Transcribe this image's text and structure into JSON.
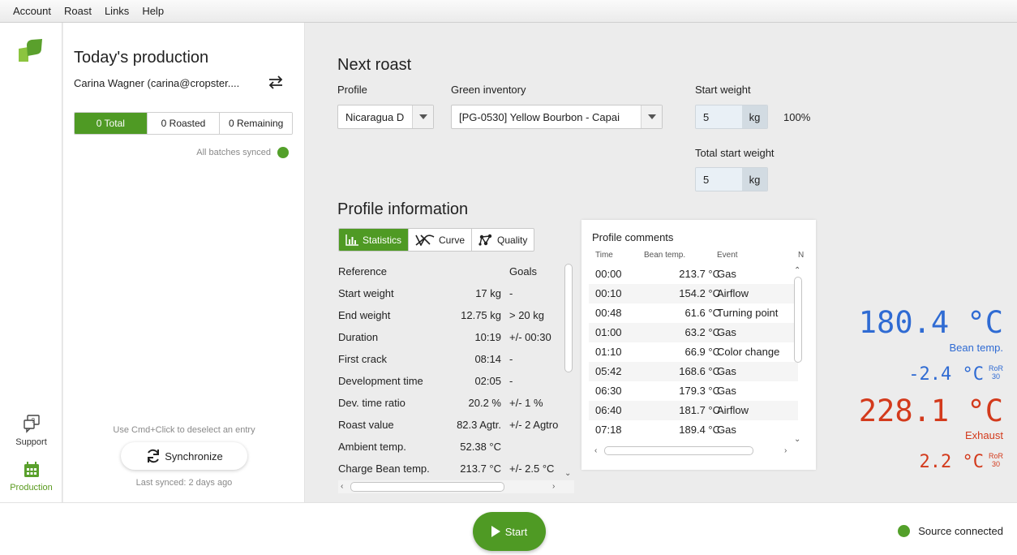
{
  "menu": [
    "Account",
    "Roast",
    "Links",
    "Help"
  ],
  "rail": {
    "support_label": "Support",
    "production_label": "Production"
  },
  "production": {
    "title": "Today's production",
    "user": "Carina Wagner (carina@cropster....",
    "segments": [
      "0 Total",
      "0 Roasted",
      "0 Remaining"
    ],
    "synced_text": "All batches synced",
    "hint": "Use Cmd+Click to deselect an entry",
    "sync_button": "Synchronize",
    "last_synced": "Last synced: 2 days ago"
  },
  "next_roast": {
    "title": "Next roast",
    "profile_label": "Profile",
    "profile_value": "Nicaragua D",
    "inventory_label": "Green inventory",
    "inventory_value": "[PG-0530] Yellow Bourbon - Capai",
    "start_weight_label": "Start weight",
    "start_weight_value": "5",
    "start_weight_unit": "kg",
    "start_weight_pct": "100%",
    "total_start_weight_label": "Total start weight",
    "total_start_weight_value": "5",
    "total_start_weight_unit": "kg"
  },
  "profile_info": {
    "title": "Profile information",
    "tabs": [
      "Statistics",
      "Curve",
      "Quality"
    ],
    "header": {
      "name": "Reference",
      "goal": "Goals"
    },
    "rows": [
      {
        "name": "Start weight",
        "value": "17 kg",
        "goal": "-"
      },
      {
        "name": "End weight",
        "value": "12.75 kg",
        "goal": "> 20 kg"
      },
      {
        "name": "Duration",
        "value": "10:19",
        "goal": "+/- 00:30"
      },
      {
        "name": "First crack",
        "value": "08:14",
        "goal": "-"
      },
      {
        "name": "Development time",
        "value": "02:05",
        "goal": "-"
      },
      {
        "name": "Dev. time ratio",
        "value": "20.2 %",
        "goal": "+/- 1 %"
      },
      {
        "name": "Roast value",
        "value": "82.3 Agtr.",
        "goal": "+/- 2 Agtro"
      },
      {
        "name": "Ambient temp.",
        "value": "52.38 °C",
        "goal": ""
      },
      {
        "name": "Charge Bean temp.",
        "value": "213.7 °C",
        "goal": "+/- 2.5 °C"
      }
    ]
  },
  "comments": {
    "title": "Profile comments",
    "headers": [
      "Time",
      "Bean temp.",
      "Event",
      "N"
    ],
    "rows": [
      {
        "time": "00:00",
        "temp": "213.7 °C",
        "event": "Gas"
      },
      {
        "time": "00:10",
        "temp": "154.2 °C",
        "event": "Airflow"
      },
      {
        "time": "00:48",
        "temp": "61.6 °C",
        "event": "Turning point"
      },
      {
        "time": "01:00",
        "temp": "63.2 °C",
        "event": "Gas"
      },
      {
        "time": "01:10",
        "temp": "66.9 °C",
        "event": "Color change"
      },
      {
        "time": "05:42",
        "temp": "168.6 °C",
        "event": "Gas"
      },
      {
        "time": "06:30",
        "temp": "179.3 °C",
        "event": "Gas"
      },
      {
        "time": "06:40",
        "temp": "181.7 °C",
        "event": "Airflow"
      },
      {
        "time": "07:18",
        "temp": "189.4 °C",
        "event": "Gas"
      }
    ]
  },
  "readouts": {
    "bean_temp": "180.4 °C",
    "bean_label": "Bean temp.",
    "bean_ror": "-2.4 °C",
    "ror_label": "RoR",
    "ror_interval": "30",
    "exhaust_temp": "228.1 °C",
    "exhaust_label": "Exhaust",
    "exhaust_ror": "2.2 °C"
  },
  "bottom": {
    "start_button": "Start",
    "source_status": "Source connected"
  },
  "colors": {
    "accent_green": "#4f9a24",
    "bean_blue": "#2f6bd3",
    "exhaust_red": "#d33a1c"
  }
}
